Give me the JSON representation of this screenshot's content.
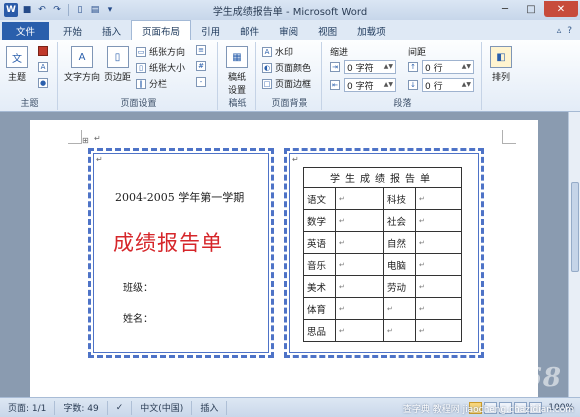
{
  "window": {
    "title": "学生成绩报告单 - Microsoft Word",
    "app_icon": "W",
    "minimize": "─",
    "maximize": "□",
    "close": "✕"
  },
  "ribbon_tabs": {
    "file": "文件",
    "items": [
      "开始",
      "插入",
      "页面布局",
      "引用",
      "邮件",
      "审阅",
      "视图",
      "加载项"
    ],
    "active": "页面布局"
  },
  "groups": {
    "theme": {
      "label": "主题",
      "theme_btn": "主题"
    },
    "page_setup": {
      "label": "页面设置",
      "text_direction": "文字方向",
      "margins": "页边距",
      "orientation": "纸张方向",
      "size": "纸张大小",
      "columns": "分栏"
    },
    "manuscript": {
      "label": "稿纸",
      "btn_line1": "稿纸",
      "btn_line2": "设置"
    },
    "page_background": {
      "label": "页面背景",
      "watermark": "水印",
      "page_color": "页面颜色",
      "page_borders": "页面边框"
    },
    "paragraph": {
      "label": "段落",
      "indent_label": "缩进",
      "spacing_label": "间距",
      "indent_left": "0 字符",
      "indent_right": "0 字符",
      "spacing_before": "0 行",
      "spacing_after": "0 行"
    },
    "arrange": {
      "label": "排列",
      "arrange_btn": "排列"
    }
  },
  "document": {
    "left_panel": {
      "semester": "2004-2005 学年第一学期",
      "title": "成绩报告单",
      "class_label": "班级：",
      "name_label": "姓名："
    },
    "report_table": {
      "header": "学生成绩报告单",
      "rows": [
        [
          "语文",
          "",
          "科技",
          ""
        ],
        [
          "数学",
          "",
          "社会",
          ""
        ],
        [
          "英语",
          "",
          "自然",
          ""
        ],
        [
          "音乐",
          "",
          "电脑",
          ""
        ],
        [
          "美术",
          "",
          "劳动",
          ""
        ],
        [
          "体育",
          "",
          "",
          ""
        ],
        [
          "思品",
          "",
          "",
          ""
        ]
      ]
    },
    "paragraph_mark": "↵"
  },
  "status_bar": {
    "page": "页面: 1/1",
    "words": "字数: 49",
    "language": "中文(中国)",
    "mode": "插入",
    "zoom": "100%"
  },
  "watermark": {
    "big": "IT168",
    "site": "jiaocheng.chazidian.com",
    "tag": "查字典 教程网"
  },
  "colors": {
    "accent": "#2a5fac",
    "frame_border": "#4e73c7",
    "title_red": "#d6262a"
  }
}
